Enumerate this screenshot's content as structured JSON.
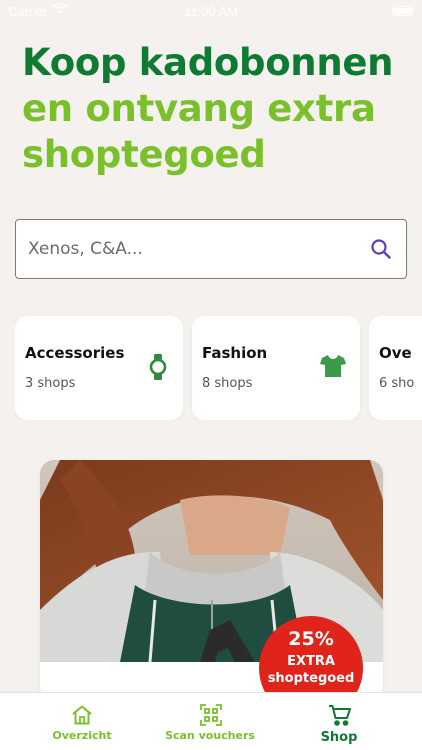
{
  "status": {
    "carrier": "Carrier",
    "time": "11:00 AM"
  },
  "headline": {
    "line1": "Koop kadobonnen",
    "line2": "en ontvang extra",
    "line3": "shoptegoed"
  },
  "search": {
    "placeholder": "Xenos, C&A..."
  },
  "categories": [
    {
      "title": "Accessories",
      "count": "3 shops",
      "icon": "watch-icon"
    },
    {
      "title": "Fashion",
      "count": "8 shops",
      "icon": "tshirt-icon"
    },
    {
      "title": "Ove",
      "count": "6 sho",
      "icon": ""
    }
  ],
  "promo": {
    "badge_percent": "25%",
    "badge_line1": "EXTRA",
    "badge_line2": "shoptegoed"
  },
  "tabs": [
    {
      "label": "Overzicht",
      "icon": "home-icon"
    },
    {
      "label": "Scan vouchers",
      "icon": "qr-icon"
    },
    {
      "label": "Shop",
      "icon": "cart-icon"
    }
  ],
  "colors": {
    "background": "#f4f1ee",
    "dark_green": "#0e7a32",
    "light_green": "#7ac02a",
    "badge_red": "#e0241b"
  }
}
